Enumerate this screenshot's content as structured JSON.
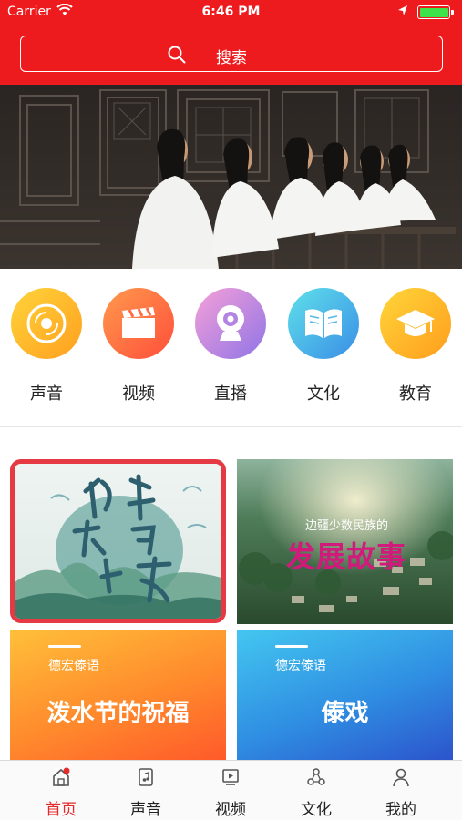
{
  "status_bar": {
    "carrier": "Carrier",
    "time": "6:46 PM",
    "battery_level": 1.0
  },
  "search": {
    "label": "搜索"
  },
  "categories": [
    {
      "label": "声音",
      "icon": "vinyl-disc-icon",
      "color": "#ffb62b"
    },
    {
      "label": "视频",
      "icon": "clapperboard-icon",
      "color": "#ff6f3d"
    },
    {
      "label": "直播",
      "icon": "webcam-icon",
      "color": "#b77ce0"
    },
    {
      "label": "文化",
      "icon": "open-book-icon",
      "color": "#3fb6ea"
    },
    {
      "label": "教育",
      "icon": "graduation-cap-icon",
      "color": "#ffb72c"
    }
  ],
  "cards": {
    "card3": {
      "tag": "德宏傣语",
      "title": "泼水节的祝福"
    },
    "card4": {
      "tag": "德宏傣语",
      "title": "傣戏"
    }
  },
  "promo": {
    "small": "边疆少数民族的",
    "big": "发展故事"
  },
  "tabs": [
    {
      "label": "首页",
      "icon": "home-icon",
      "active": true
    },
    {
      "label": "声音",
      "icon": "music-note-icon",
      "active": false
    },
    {
      "label": "视频",
      "icon": "video-play-icon",
      "active": false
    },
    {
      "label": "文化",
      "icon": "share-nodes-icon",
      "active": false
    },
    {
      "label": "我的",
      "icon": "person-icon",
      "active": false
    }
  ],
  "colors": {
    "brand_red": "#ee1b1e",
    "active_tab": "#e52a2a"
  }
}
